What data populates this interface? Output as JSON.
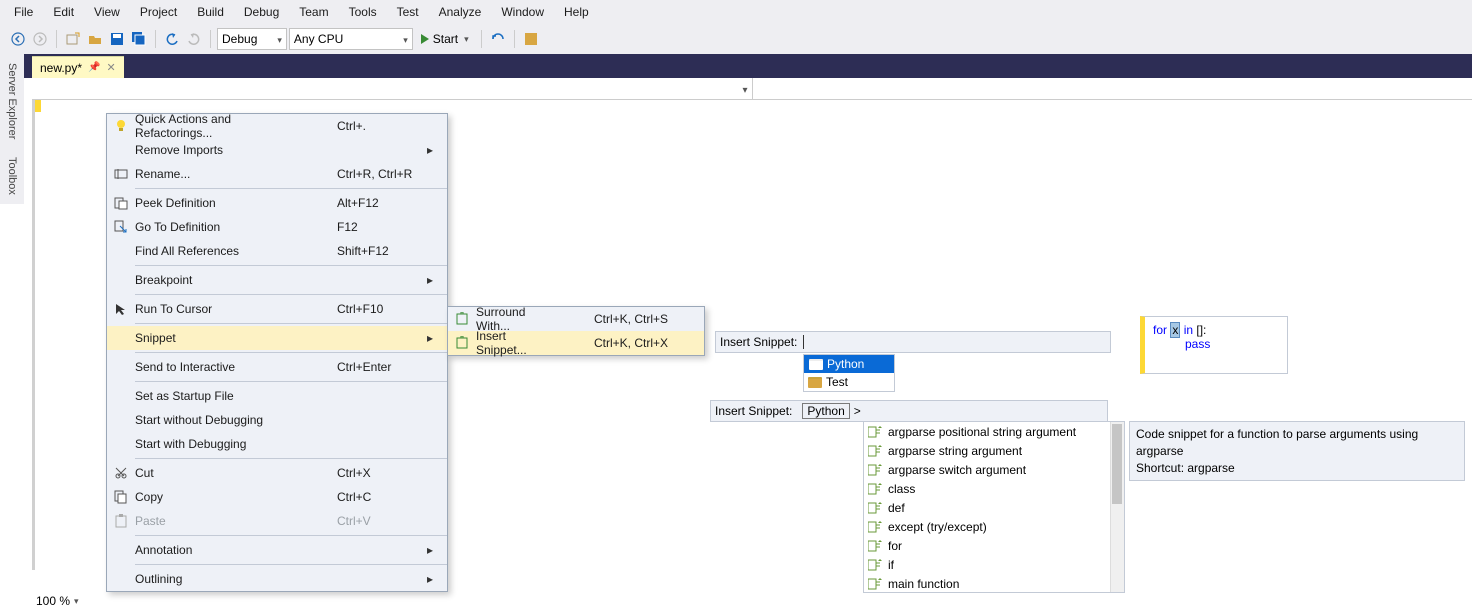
{
  "menu": [
    "File",
    "Edit",
    "View",
    "Project",
    "Build",
    "Debug",
    "Team",
    "Tools",
    "Test",
    "Analyze",
    "Window",
    "Help"
  ],
  "toolbar": {
    "config": "Debug",
    "platform": "Any CPU",
    "start": "Start"
  },
  "tab": {
    "name": "new.py*"
  },
  "sidepanels": {
    "explorer": "Server Explorer",
    "toolbox": "Toolbox"
  },
  "context_menu": [
    {
      "icon": "bulb",
      "label": "Quick Actions and Refactorings...",
      "shortcut": "Ctrl+."
    },
    {
      "icon": "",
      "label": "Remove Imports",
      "submenu": true
    },
    {
      "icon": "rename",
      "label": "Rename...",
      "shortcut": "Ctrl+R, Ctrl+R"
    },
    {
      "sep": true
    },
    {
      "icon": "peek",
      "label": "Peek Definition",
      "shortcut": "Alt+F12"
    },
    {
      "icon": "goto",
      "label": "Go To Definition",
      "shortcut": "F12"
    },
    {
      "icon": "",
      "label": "Find All References",
      "shortcut": "Shift+F12"
    },
    {
      "sep": true
    },
    {
      "icon": "",
      "label": "Breakpoint",
      "submenu": true
    },
    {
      "sep": true
    },
    {
      "icon": "cursor",
      "label": "Run To Cursor",
      "shortcut": "Ctrl+F10"
    },
    {
      "sep": true
    },
    {
      "icon": "",
      "label": "Snippet",
      "submenu": true,
      "hover": true
    },
    {
      "sep": true
    },
    {
      "icon": "",
      "label": "Send to Interactive",
      "shortcut": "Ctrl+Enter"
    },
    {
      "sep": true
    },
    {
      "icon": "",
      "label": "Set as Startup File"
    },
    {
      "icon": "",
      "label": "Start without Debugging"
    },
    {
      "icon": "",
      "label": "Start with Debugging"
    },
    {
      "sep": true
    },
    {
      "icon": "cut",
      "label": "Cut",
      "shortcut": "Ctrl+X"
    },
    {
      "icon": "copy",
      "label": "Copy",
      "shortcut": "Ctrl+C"
    },
    {
      "icon": "paste",
      "label": "Paste",
      "shortcut": "Ctrl+V",
      "disabled": true
    },
    {
      "sep": true
    },
    {
      "icon": "",
      "label": "Annotation",
      "submenu": true
    },
    {
      "sep": true
    },
    {
      "icon": "",
      "label": "Outlining",
      "submenu": true
    }
  ],
  "snippet_submenu": [
    {
      "label": "Surround With...",
      "shortcut": "Ctrl+K, Ctrl+S"
    },
    {
      "label": "Insert Snippet...",
      "shortcut": "Ctrl+K, Ctrl+X",
      "hover": true
    }
  ],
  "snippet_picker1": {
    "label": "Insert Snippet:",
    "folders": [
      "Python",
      "Test"
    ],
    "selected": "Python"
  },
  "snippet_picker2": {
    "label": "Insert Snippet:",
    "crumb": "Python",
    "sep": ">"
  },
  "snippet_list": [
    "argparse positional string argument",
    "argparse string argument",
    "argparse switch argument",
    "class",
    "def",
    "except (try/except)",
    "for",
    "if",
    "main function"
  ],
  "tooltip": {
    "line1": "Code snippet for a function to parse arguments using argparse",
    "line2": "Shortcut: argparse"
  },
  "code_preview": {
    "kw_for": "for",
    "var": "x",
    "kw_in": "in",
    "list": "[]:",
    "kw_pass": "pass"
  },
  "zoom": "100 %"
}
